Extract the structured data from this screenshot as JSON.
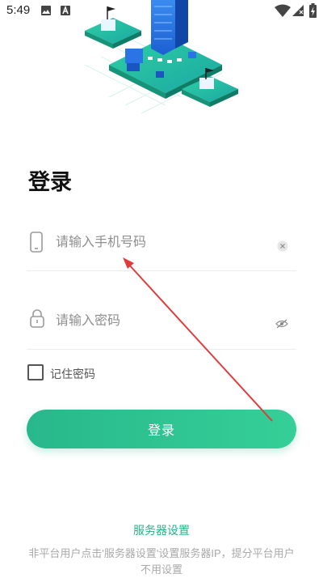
{
  "status_bar": {
    "time": "5:49",
    "icons": [
      "image-icon",
      "a-letter-icon",
      "wifi-icon",
      "signal-icon",
      "battery-charging-icon"
    ]
  },
  "login": {
    "title": "登录",
    "phone_placeholder": "请输入手机号码",
    "password_placeholder": "请输入密码",
    "remember_label": "记住密码",
    "button_label": "登录"
  },
  "footer": {
    "server_link": "服务器设置",
    "note": "非平台用户点击'服务器设置'设置服务器IP，提分平台用户不用设置"
  },
  "colors": {
    "accent": "#28b88b",
    "annotation_arrow": "#e03c3c"
  }
}
